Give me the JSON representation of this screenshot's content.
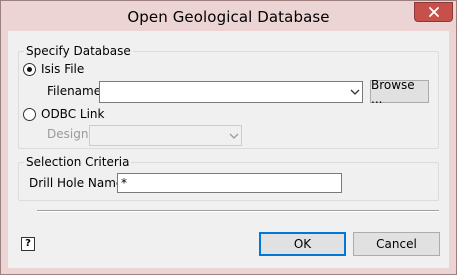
{
  "window": {
    "title": "Open Geological Database"
  },
  "specify_database": {
    "group_title": "Specify Database",
    "isis_file": {
      "label": "Isis File",
      "selected": true
    },
    "filename": {
      "label": "Filename",
      "value": ""
    },
    "browse_label": "Browse ...",
    "odbc_link": {
      "label": "ODBC Link",
      "selected": false
    },
    "design": {
      "label": "Design",
      "value": ""
    }
  },
  "selection_criteria": {
    "group_title": "Selection Criteria",
    "drill_hole_name": {
      "label": "Drill Hole Name",
      "value": "*"
    }
  },
  "footer": {
    "help_glyph": "?",
    "ok_label": "OK",
    "cancel_label": "Cancel"
  },
  "colors": {
    "title_bar": "#ecd4d4",
    "close_button": "#c7504a",
    "dialog_background": "#f0f0f0",
    "default_button_border": "#0078d7"
  }
}
